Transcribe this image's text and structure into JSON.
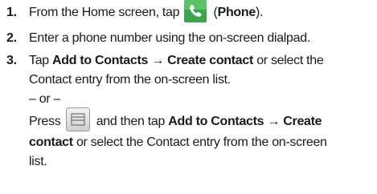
{
  "steps": [
    {
      "number": "1.",
      "before": "From the Home screen, tap ",
      "icon": "phone-icon",
      "after_open": " (",
      "bold": "Phone",
      "after_close": ")."
    },
    {
      "number": "2.",
      "text": "Enter a phone number using the on-screen dialpad."
    },
    {
      "number": "3.",
      "line1_pre": "Tap ",
      "line1_bold": "Add to Contacts → Create contact",
      "line1_post": " or select the",
      "line2": "Contact entry from the on-screen list.",
      "or": "– or –",
      "line4_pre": "Press ",
      "icon": "menu-icon",
      "line4_mid": " and then tap ",
      "line4_bold": "Add to Contacts → Create",
      "line5_bold": "contact",
      "line5_post": " or select the Contact entry from the on-screen",
      "line6": "list."
    }
  ],
  "colors": {
    "phone_icon_bg": "#3aa54a",
    "text": "#1a1a1a"
  }
}
